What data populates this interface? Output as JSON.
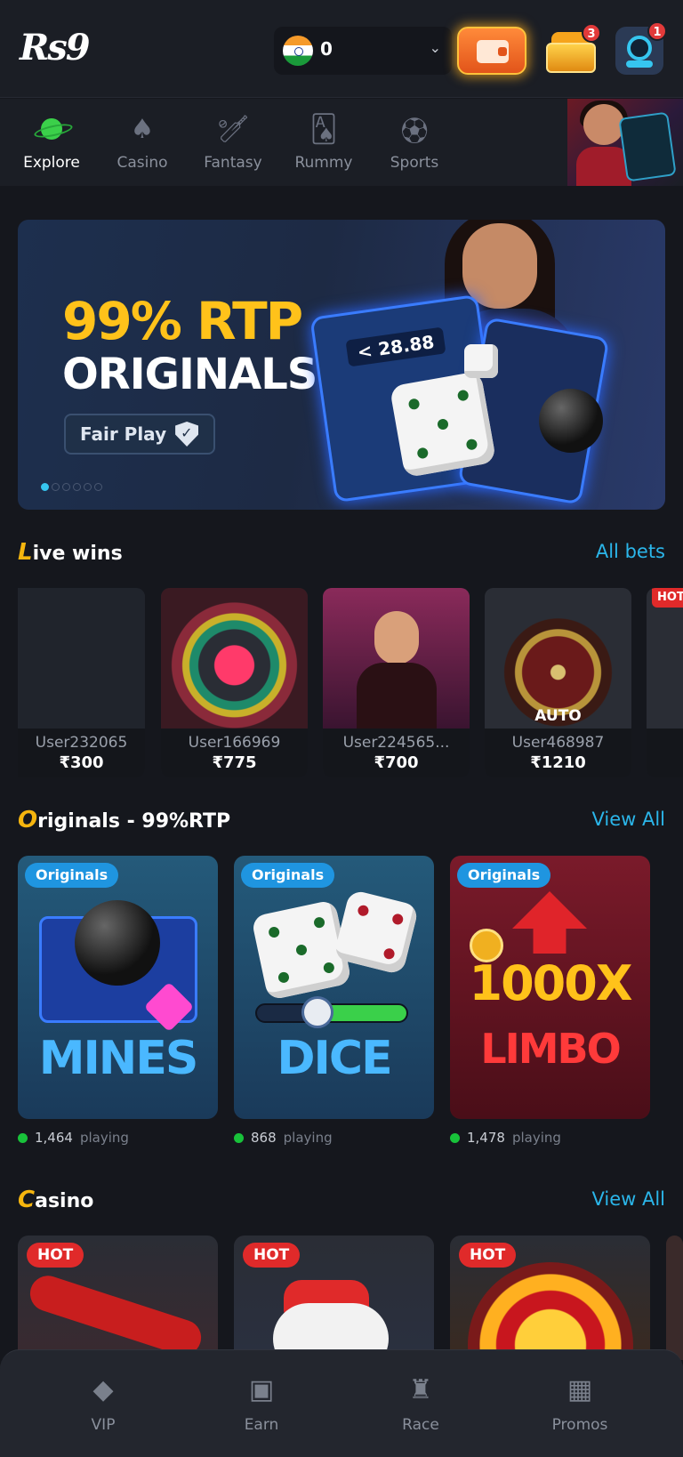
{
  "header": {
    "logo": "Rs9",
    "balance": "0",
    "gift_badge": "3",
    "support_badge": "1"
  },
  "nav": {
    "tabs": [
      {
        "label": "Explore",
        "icon": "planet-icon",
        "active": true
      },
      {
        "label": "Casino",
        "icon": "spade-icon"
      },
      {
        "label": "Fantasy",
        "icon": "cricket-bat-icon"
      },
      {
        "label": "Rummy",
        "icon": "cards-icon"
      },
      {
        "label": "Sports",
        "icon": "football-icon"
      }
    ]
  },
  "hero": {
    "title": "99% RTP",
    "subtitle": "ORIGINALS",
    "badge": "Fair Play",
    "multiplier": "< 28.88",
    "slide_index": 1,
    "slide_count": 6
  },
  "live_wins": {
    "title_cap": "L",
    "title_rest": "ive wins",
    "link": "All bets",
    "items": [
      {
        "user": "User232065",
        "amount": "₹300"
      },
      {
        "user": "User166969",
        "amount": "₹775"
      },
      {
        "user": "User224565...",
        "amount": "₹700"
      },
      {
        "user": "User468987",
        "amount": "₹1210"
      }
    ],
    "overlay_text": "AUTO",
    "hot_tag": "HOT"
  },
  "originals": {
    "title_cap": "O",
    "title_rest": "riginals - 99%RTP",
    "link": "View All",
    "tag": "Originals",
    "playing_label": "playing",
    "games": [
      {
        "name": "MINES",
        "players": "1,464"
      },
      {
        "name": "DICE",
        "players": "868"
      },
      {
        "name": "1000X",
        "name2": "LIMBO",
        "players": "1,478"
      }
    ]
  },
  "casino": {
    "title_cap": "C",
    "title_rest": "asino",
    "link": "View All",
    "hot_tag": "HOT"
  },
  "bottom_nav": {
    "items": [
      {
        "label": "VIP",
        "icon": "diamond-icon"
      },
      {
        "label": "Earn",
        "icon": "money-icon"
      },
      {
        "label": "Race",
        "icon": "trophy-icon"
      },
      {
        "label": "Promos",
        "icon": "gift-icon"
      }
    ]
  },
  "colors": {
    "accent": "#2bb6ea",
    "gold": "#ffc21a",
    "hot": "#e02a2a",
    "online": "#18c23a"
  }
}
